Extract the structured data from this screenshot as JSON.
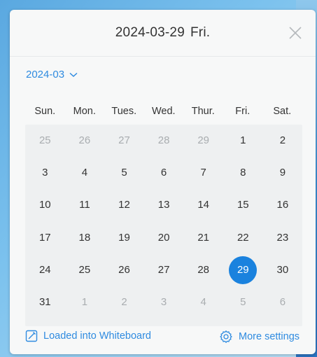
{
  "header": {
    "date": "2024-03-29",
    "weekday": "Fri."
  },
  "month_picker": {
    "label": "2024-03"
  },
  "weekdays": [
    "Sun.",
    "Mon.",
    "Tues.",
    "Wed.",
    "Thur.",
    "Fri.",
    "Sat."
  ],
  "weeks": [
    [
      {
        "d": "25",
        "o": true
      },
      {
        "d": "26",
        "o": true
      },
      {
        "d": "27",
        "o": true
      },
      {
        "d": "28",
        "o": true
      },
      {
        "d": "29",
        "o": true
      },
      {
        "d": "1"
      },
      {
        "d": "2"
      }
    ],
    [
      {
        "d": "3"
      },
      {
        "d": "4"
      },
      {
        "d": "5"
      },
      {
        "d": "6"
      },
      {
        "d": "7"
      },
      {
        "d": "8"
      },
      {
        "d": "9"
      }
    ],
    [
      {
        "d": "10"
      },
      {
        "d": "11"
      },
      {
        "d": "12"
      },
      {
        "d": "13"
      },
      {
        "d": "14"
      },
      {
        "d": "15"
      },
      {
        "d": "16"
      }
    ],
    [
      {
        "d": "17"
      },
      {
        "d": "18"
      },
      {
        "d": "19"
      },
      {
        "d": "20"
      },
      {
        "d": "21"
      },
      {
        "d": "22"
      },
      {
        "d": "23"
      }
    ],
    [
      {
        "d": "24"
      },
      {
        "d": "25"
      },
      {
        "d": "26"
      },
      {
        "d": "27"
      },
      {
        "d": "28"
      },
      {
        "d": "29",
        "s": true
      },
      {
        "d": "30"
      }
    ],
    [
      {
        "d": "31"
      },
      {
        "d": "1",
        "o": true
      },
      {
        "d": "2",
        "o": true
      },
      {
        "d": "3",
        "o": true
      },
      {
        "d": "4",
        "o": true
      },
      {
        "d": "5",
        "o": true
      },
      {
        "d": "6",
        "o": true
      }
    ]
  ],
  "footer": {
    "left_label": "Loaded into Whiteboard",
    "right_label": "More settings",
    "left_icon": "edit-icon",
    "right_icon": "gear-icon"
  },
  "colors": {
    "accent": "#2f8be0",
    "selected": "#1a82de"
  }
}
